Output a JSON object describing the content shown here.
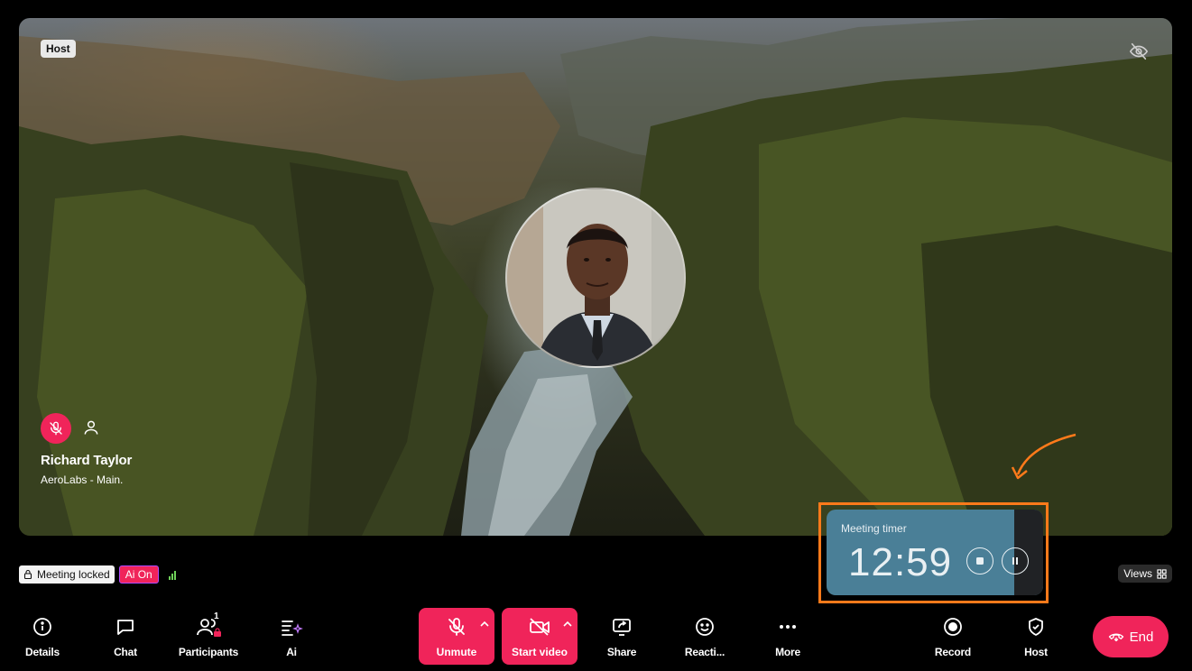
{
  "stage": {
    "host_tag": "Host",
    "participant": {
      "name": "Richard Taylor",
      "subtitle": "AeroLabs - Main."
    }
  },
  "timer": {
    "label": "Meeting timer",
    "value": "12:59"
  },
  "status": {
    "lock_label": "Meeting locked",
    "ai_label": "Ai On"
  },
  "views_label": "Views",
  "toolbar": {
    "details": "Details",
    "chat": "Chat",
    "participants": "Participants",
    "participants_count": "1",
    "ai": "Ai",
    "unmute": "Unmute",
    "start_video": "Start video",
    "share": "Share",
    "reactions": "Reacti...",
    "more": "More",
    "record": "Record",
    "host": "Host",
    "end": "End"
  },
  "colors": {
    "accent_pink": "#f0245a",
    "timer_bg": "#4a7f97",
    "highlight_orange": "#ff7a1a",
    "signal_green": "#6fd05a"
  }
}
